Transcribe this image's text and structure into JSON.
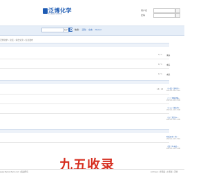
{
  "header": {
    "logo_text": "泛博化学",
    "logo_sub": "FANBOCHEM",
    "username_label": "用户名",
    "password_label": "密码"
  },
  "nav": {
    "search_select": "帖子",
    "hot_label": "热搜:",
    "hot_links": [
      "活动",
      "交友",
      "discuz"
    ]
  },
  "breadcrumb": "泛博化学 › 论坛 › 综合交流 › 信息发布",
  "section1": {
    "rows": [
      {
        "num": "0 / 1",
        "txt": "未来"
      },
      {
        "num": "0 / 1",
        "txt": "未来"
      },
      {
        "num": "0 / 1",
        "txt": "未来"
      }
    ]
  },
  "section2": {
    "rows": [
      {
        "num": "18 / 18",
        "link": "（十四）溴阿尔...",
        "date": "2022-1-10 13:19"
      },
      {
        "num": "",
        "link": "（三）溴胺羟嗪...",
        "date": "2022-1-10 13:09"
      },
      {
        "num": "",
        "link": "（十二）溴比利...",
        "date": "2022-1-10 13:08"
      },
      {
        "num": "",
        "link": "（五）溴比卡...",
        "date": "2022-1-10 13:09"
      }
    ]
  },
  "section3": {
    "rows": [
      {
        "link": "附近其他一些...",
        "date": "2022-1-10 13:10"
      },
      {
        "link": "（四）阿卡波...",
        "date": "2022-1-10 13:08"
      }
    ]
  },
  "footer": {
    "left": "www.fanbochem.com | 版权所有",
    "links": [
      "Archiver",
      "手机版",
      "小黑屋",
      "泛博"
    ]
  },
  "watermark": "九五收录"
}
